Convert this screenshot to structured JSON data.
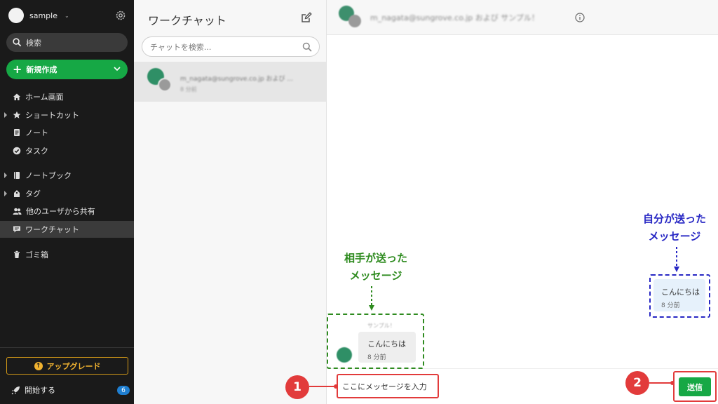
{
  "sidebar": {
    "account_name": "sample",
    "search_label": "検索",
    "new_button": "新規作成",
    "items": [
      {
        "label": "ホーム画面"
      },
      {
        "label": "ショートカット"
      },
      {
        "label": "ノート"
      },
      {
        "label": "タスク"
      },
      {
        "label": "ノートブック"
      },
      {
        "label": "タグ"
      },
      {
        "label": "他のユーザから共有"
      },
      {
        "label": "ワークチャット"
      },
      {
        "label": "ゴミ箱"
      }
    ],
    "upgrade_label": "アップグレード",
    "start_label": "開始する",
    "start_badge": "6"
  },
  "chatlist": {
    "title": "ワークチャット",
    "search_placeholder": "チャットを検索...",
    "item_name": "m_nagata@sungrove.co.jp および ...",
    "item_time": "8 分前"
  },
  "pane": {
    "header_title": "m_nagata@sungrove.co.jp および サンプル！",
    "incoming_sender": "サンプル！",
    "incoming_text": "こんにちは",
    "incoming_time": "8 分前",
    "outgoing_text": "こんにちは",
    "outgoing_time": "8 分前",
    "input_placeholder": "ここにメッセージを入力",
    "send_label": "送信"
  },
  "annotations": {
    "green_line1": "相手が送った",
    "green_line2": "メッセージ",
    "blue_line1": "自分が送った",
    "blue_line2": "メッセージ",
    "num1": "1",
    "num2": "2",
    "colors": {
      "red": "#e23b3b",
      "green": "#2e8b1f",
      "blue": "#2727c4"
    }
  }
}
